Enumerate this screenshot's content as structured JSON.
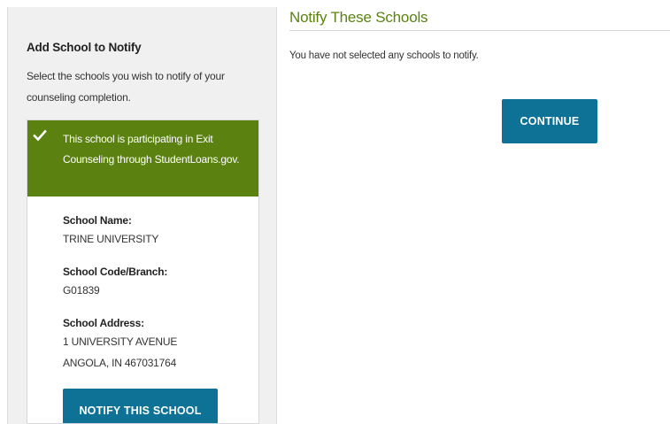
{
  "sidebar": {
    "heading": "Add School to Notify",
    "intro": "Select the schools you wish to notify of your counseling completion.",
    "card": {
      "banner_icon": "checkmark-icon",
      "banner_text": "This school is participating in Exit Counseling through StudentLoans.gov.",
      "school_name_label": "School Name:",
      "school_name": "TRINE UNIVERSITY",
      "school_code_label": "School Code/Branch:",
      "school_code": "G01839",
      "school_address_label": "School Address:",
      "address_line1": "1 UNIVERSITY AVENUE",
      "address_line2": "ANGOLA, IN 467031764",
      "notify_button": "NOTIFY THIS SCHOOL"
    }
  },
  "main": {
    "title": "Notify These Schools",
    "empty_message": "You have not selected any schools to notify.",
    "continue_button": "CONTINUE"
  },
  "colors": {
    "accent_green": "#5b8211",
    "button_blue": "#0e7196",
    "sidebar_bg": "#f0f0f0"
  }
}
